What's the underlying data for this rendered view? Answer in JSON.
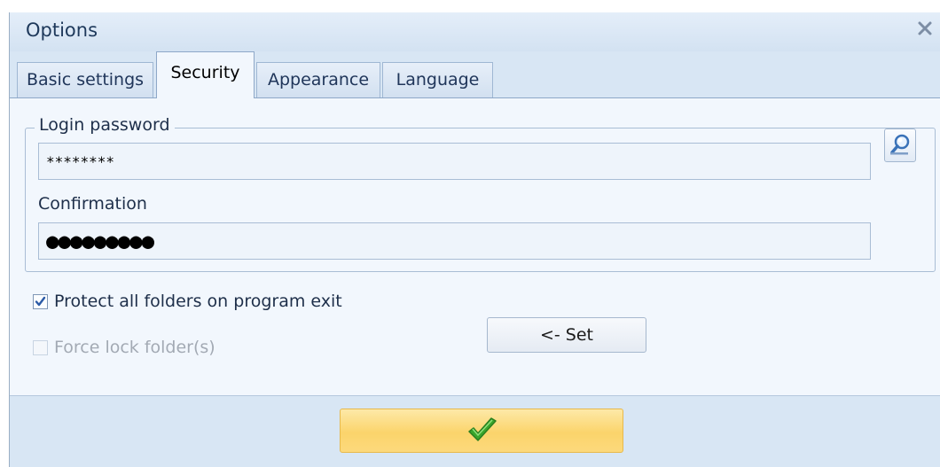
{
  "window": {
    "title": "Options"
  },
  "tabs": [
    {
      "label": "Basic settings",
      "active": false
    },
    {
      "label": "Security",
      "active": true
    },
    {
      "label": "Appearance",
      "active": false
    },
    {
      "label": "Language",
      "active": false
    }
  ],
  "security": {
    "group_label": "Login password",
    "password_value": "********",
    "confirmation_label": "Confirmation",
    "confirmation_value": "●●●●●●●●●",
    "protect_label": "Protect all folders on program exit",
    "protect_checked": true,
    "force_lock_label": "Force lock folder(s)",
    "force_lock_checked": false,
    "force_lock_enabled": false,
    "set_button_label": "<- Set"
  },
  "icons": {
    "close": "close-icon",
    "reveal": "magnifier-icon",
    "ok": "checkmark-icon"
  },
  "colors": {
    "ok_button": "#fbd46b",
    "checkmark": "#3aa52c",
    "check_tick": "#2b5aa6"
  }
}
